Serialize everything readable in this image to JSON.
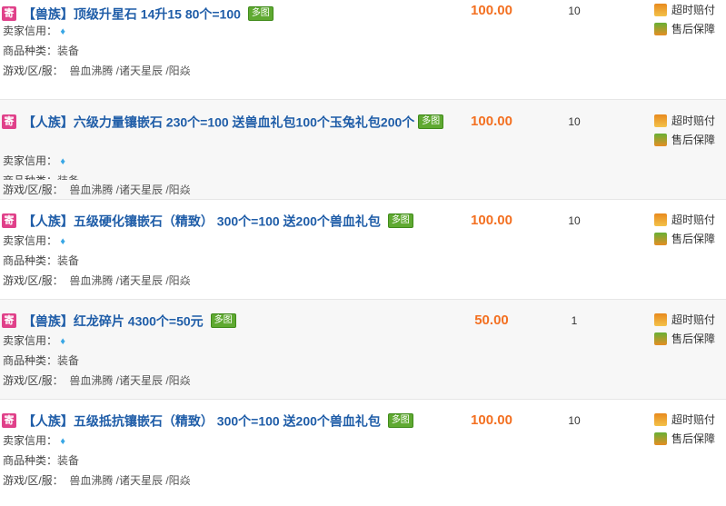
{
  "labels": {
    "seller_credit": "卖家信用：",
    "category": "商品种类：",
    "server": "游戏/区/服：",
    "consign_badge": "寄",
    "pic_badge": "多图",
    "svc_timeout": "超时赔付",
    "svc_after_sale": "售后保障",
    "credit_icon": "diamond-icon"
  },
  "colors": {
    "title": "#1f5da8",
    "price": "#f37021",
    "consign_badge": "#e0418a",
    "pic_badge": "#5fa931"
  },
  "listings": [
    {
      "title": "【兽族】顶级升星石  14升15 80个=100",
      "category": "装备",
      "server": "兽血沸腾 /诸天星辰 /阳焱",
      "price": "100.00",
      "qty": "10"
    },
    {
      "title": "【人族】六级力量镶嵌石  230个=100 送兽血礼包100个玉兔礼包200个",
      "category": "装备",
      "server": "兽血沸腾 /诸天星辰 /阳焱",
      "price": "100.00",
      "qty": "10"
    },
    {
      "title": "【人族】五级硬化镶嵌石（精致）  300个=100 送200个兽血礼包",
      "category": "装备",
      "server": "兽血沸腾 /诸天星辰 /阳焱",
      "price": "100.00",
      "qty": "10"
    },
    {
      "title": "【兽族】红龙碎片  4300个=50元",
      "category": "装备",
      "server": "兽血沸腾 /诸天星辰 /阳焱",
      "price": "50.00",
      "qty": "1"
    },
    {
      "title": "【人族】五级抵抗镶嵌石（精致）  300个=100 送200个兽血礼包",
      "category": "装备",
      "server": "兽血沸腾 /诸天星辰 /阳焱",
      "price": "100.00",
      "qty": "10"
    }
  ]
}
